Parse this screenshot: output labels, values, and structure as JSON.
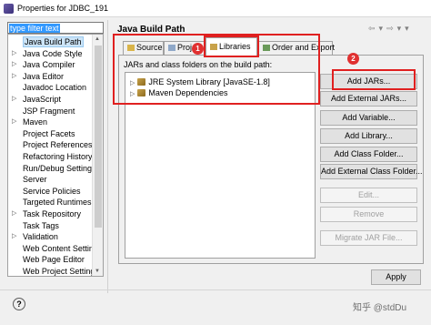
{
  "window": {
    "title": "Properties for JDBC_191"
  },
  "filter": {
    "value": "type filter text"
  },
  "tree": {
    "items": [
      {
        "label": "Java Build Path",
        "selected": true
      },
      {
        "label": "Java Code Style",
        "expandable": true
      },
      {
        "label": "Java Compiler",
        "expandable": true
      },
      {
        "label": "Java Editor",
        "expandable": true
      },
      {
        "label": "Javadoc Location"
      },
      {
        "label": "JavaScript",
        "expandable": true
      },
      {
        "label": "JSP Fragment"
      },
      {
        "label": "Maven",
        "expandable": true
      },
      {
        "label": "Project Facets"
      },
      {
        "label": "Project References"
      },
      {
        "label": "Refactoring History"
      },
      {
        "label": "Run/Debug Settings"
      },
      {
        "label": "Server"
      },
      {
        "label": "Service Policies"
      },
      {
        "label": "Targeted Runtimes"
      },
      {
        "label": "Task Repository",
        "expandable": true
      },
      {
        "label": "Task Tags"
      },
      {
        "label": "Validation",
        "expandable": true
      },
      {
        "label": "Web Content Settings"
      },
      {
        "label": "Web Page Editor"
      },
      {
        "label": "Web Project Settings"
      }
    ]
  },
  "main": {
    "title": "Java Build Path",
    "tabs": [
      {
        "label": "Source"
      },
      {
        "label": "Proj"
      },
      {
        "label": "Libraries",
        "active": true
      },
      {
        "label": "Order and Export"
      }
    ],
    "description": "JARs and class folders on the build path:",
    "libraries": [
      {
        "label": "JRE System Library [JavaSE-1.8]"
      },
      {
        "label": "Maven Dependencies"
      }
    ],
    "buttons": [
      {
        "label": "Add JARs...",
        "enabled": true
      },
      {
        "label": "Add External JARs...",
        "enabled": true
      },
      {
        "label": "Add Variable...",
        "enabled": true
      },
      {
        "label": "Add Library...",
        "enabled": true
      },
      {
        "label": "Add Class Folder...",
        "enabled": true
      },
      {
        "label": "Add External Class Folder...",
        "enabled": true
      },
      {
        "label": "Edit...",
        "enabled": false
      },
      {
        "label": "Remove",
        "enabled": false
      },
      {
        "label": "Migrate JAR File...",
        "enabled": false
      }
    ]
  },
  "annotations": {
    "marker1": "1",
    "marker2": "2"
  },
  "footer": {
    "apply": "Apply",
    "help": "?",
    "watermark": "知乎 @stdDu"
  },
  "colors": {
    "annotation": "#e02020",
    "selection": "#3399ff"
  }
}
